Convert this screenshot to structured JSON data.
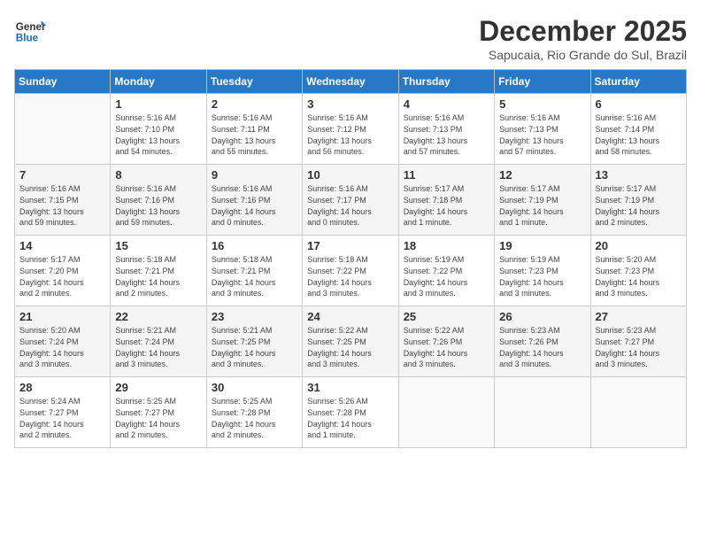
{
  "logo": {
    "line1": "General",
    "line2": "Blue"
  },
  "title": "December 2025",
  "subtitle": "Sapucaia, Rio Grande do Sul, Brazil",
  "weekdays": [
    "Sunday",
    "Monday",
    "Tuesday",
    "Wednesday",
    "Thursday",
    "Friday",
    "Saturday"
  ],
  "weeks": [
    [
      {
        "day": "",
        "info": ""
      },
      {
        "day": "1",
        "info": "Sunrise: 5:16 AM\nSunset: 7:10 PM\nDaylight: 13 hours\nand 54 minutes."
      },
      {
        "day": "2",
        "info": "Sunrise: 5:16 AM\nSunset: 7:11 PM\nDaylight: 13 hours\nand 55 minutes."
      },
      {
        "day": "3",
        "info": "Sunrise: 5:16 AM\nSunset: 7:12 PM\nDaylight: 13 hours\nand 56 minutes."
      },
      {
        "day": "4",
        "info": "Sunrise: 5:16 AM\nSunset: 7:13 PM\nDaylight: 13 hours\nand 57 minutes."
      },
      {
        "day": "5",
        "info": "Sunrise: 5:16 AM\nSunset: 7:13 PM\nDaylight: 13 hours\nand 57 minutes."
      },
      {
        "day": "6",
        "info": "Sunrise: 5:16 AM\nSunset: 7:14 PM\nDaylight: 13 hours\nand 58 minutes."
      }
    ],
    [
      {
        "day": "7",
        "info": "Sunrise: 5:16 AM\nSunset: 7:15 PM\nDaylight: 13 hours\nand 59 minutes."
      },
      {
        "day": "8",
        "info": "Sunrise: 5:16 AM\nSunset: 7:16 PM\nDaylight: 13 hours\nand 59 minutes."
      },
      {
        "day": "9",
        "info": "Sunrise: 5:16 AM\nSunset: 7:16 PM\nDaylight: 14 hours\nand 0 minutes."
      },
      {
        "day": "10",
        "info": "Sunrise: 5:16 AM\nSunset: 7:17 PM\nDaylight: 14 hours\nand 0 minutes."
      },
      {
        "day": "11",
        "info": "Sunrise: 5:17 AM\nSunset: 7:18 PM\nDaylight: 14 hours\nand 1 minute."
      },
      {
        "day": "12",
        "info": "Sunrise: 5:17 AM\nSunset: 7:19 PM\nDaylight: 14 hours\nand 1 minute."
      },
      {
        "day": "13",
        "info": "Sunrise: 5:17 AM\nSunset: 7:19 PM\nDaylight: 14 hours\nand 2 minutes."
      }
    ],
    [
      {
        "day": "14",
        "info": "Sunrise: 5:17 AM\nSunset: 7:20 PM\nDaylight: 14 hours\nand 2 minutes."
      },
      {
        "day": "15",
        "info": "Sunrise: 5:18 AM\nSunset: 7:21 PM\nDaylight: 14 hours\nand 2 minutes."
      },
      {
        "day": "16",
        "info": "Sunrise: 5:18 AM\nSunset: 7:21 PM\nDaylight: 14 hours\nand 3 minutes."
      },
      {
        "day": "17",
        "info": "Sunrise: 5:18 AM\nSunset: 7:22 PM\nDaylight: 14 hours\nand 3 minutes."
      },
      {
        "day": "18",
        "info": "Sunrise: 5:19 AM\nSunset: 7:22 PM\nDaylight: 14 hours\nand 3 minutes."
      },
      {
        "day": "19",
        "info": "Sunrise: 5:19 AM\nSunset: 7:23 PM\nDaylight: 14 hours\nand 3 minutes."
      },
      {
        "day": "20",
        "info": "Sunrise: 5:20 AM\nSunset: 7:23 PM\nDaylight: 14 hours\nand 3 minutes."
      }
    ],
    [
      {
        "day": "21",
        "info": "Sunrise: 5:20 AM\nSunset: 7:24 PM\nDaylight: 14 hours\nand 3 minutes."
      },
      {
        "day": "22",
        "info": "Sunrise: 5:21 AM\nSunset: 7:24 PM\nDaylight: 14 hours\nand 3 minutes."
      },
      {
        "day": "23",
        "info": "Sunrise: 5:21 AM\nSunset: 7:25 PM\nDaylight: 14 hours\nand 3 minutes."
      },
      {
        "day": "24",
        "info": "Sunrise: 5:22 AM\nSunset: 7:25 PM\nDaylight: 14 hours\nand 3 minutes."
      },
      {
        "day": "25",
        "info": "Sunrise: 5:22 AM\nSunset: 7:26 PM\nDaylight: 14 hours\nand 3 minutes."
      },
      {
        "day": "26",
        "info": "Sunrise: 5:23 AM\nSunset: 7:26 PM\nDaylight: 14 hours\nand 3 minutes."
      },
      {
        "day": "27",
        "info": "Sunrise: 5:23 AM\nSunset: 7:27 PM\nDaylight: 14 hours\nand 3 minutes."
      }
    ],
    [
      {
        "day": "28",
        "info": "Sunrise: 5:24 AM\nSunset: 7:27 PM\nDaylight: 14 hours\nand 2 minutes."
      },
      {
        "day": "29",
        "info": "Sunrise: 5:25 AM\nSunset: 7:27 PM\nDaylight: 14 hours\nand 2 minutes."
      },
      {
        "day": "30",
        "info": "Sunrise: 5:25 AM\nSunset: 7:28 PM\nDaylight: 14 hours\nand 2 minutes."
      },
      {
        "day": "31",
        "info": "Sunrise: 5:26 AM\nSunset: 7:28 PM\nDaylight: 14 hours\nand 1 minute."
      },
      {
        "day": "",
        "info": ""
      },
      {
        "day": "",
        "info": ""
      },
      {
        "day": "",
        "info": ""
      }
    ]
  ]
}
